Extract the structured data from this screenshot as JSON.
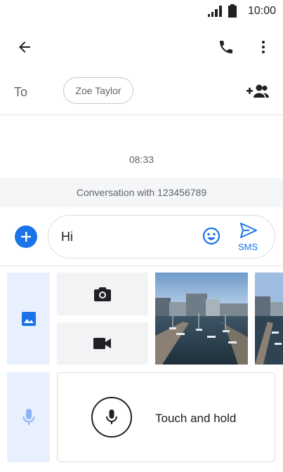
{
  "status_bar": {
    "time": "10:00"
  },
  "header": {
    "back_icon": "arrow-back-icon",
    "call_icon": "phone-icon",
    "menu_icon": "more-vert-icon"
  },
  "recipients": {
    "to_label": "To",
    "chip_name": "Zoe Taylor",
    "add_icon": "add-person-icon"
  },
  "conversation": {
    "timestamp": "08:33",
    "banner": "Conversation with 123456789"
  },
  "composer": {
    "text": "Hi",
    "send_label": "SMS"
  },
  "attachments": {
    "voice_label": "Touch and hold"
  },
  "colors": {
    "accent": "#1a73e8",
    "tile_bg": "#e8f0fe",
    "grey_bg": "#f1f3f4"
  }
}
